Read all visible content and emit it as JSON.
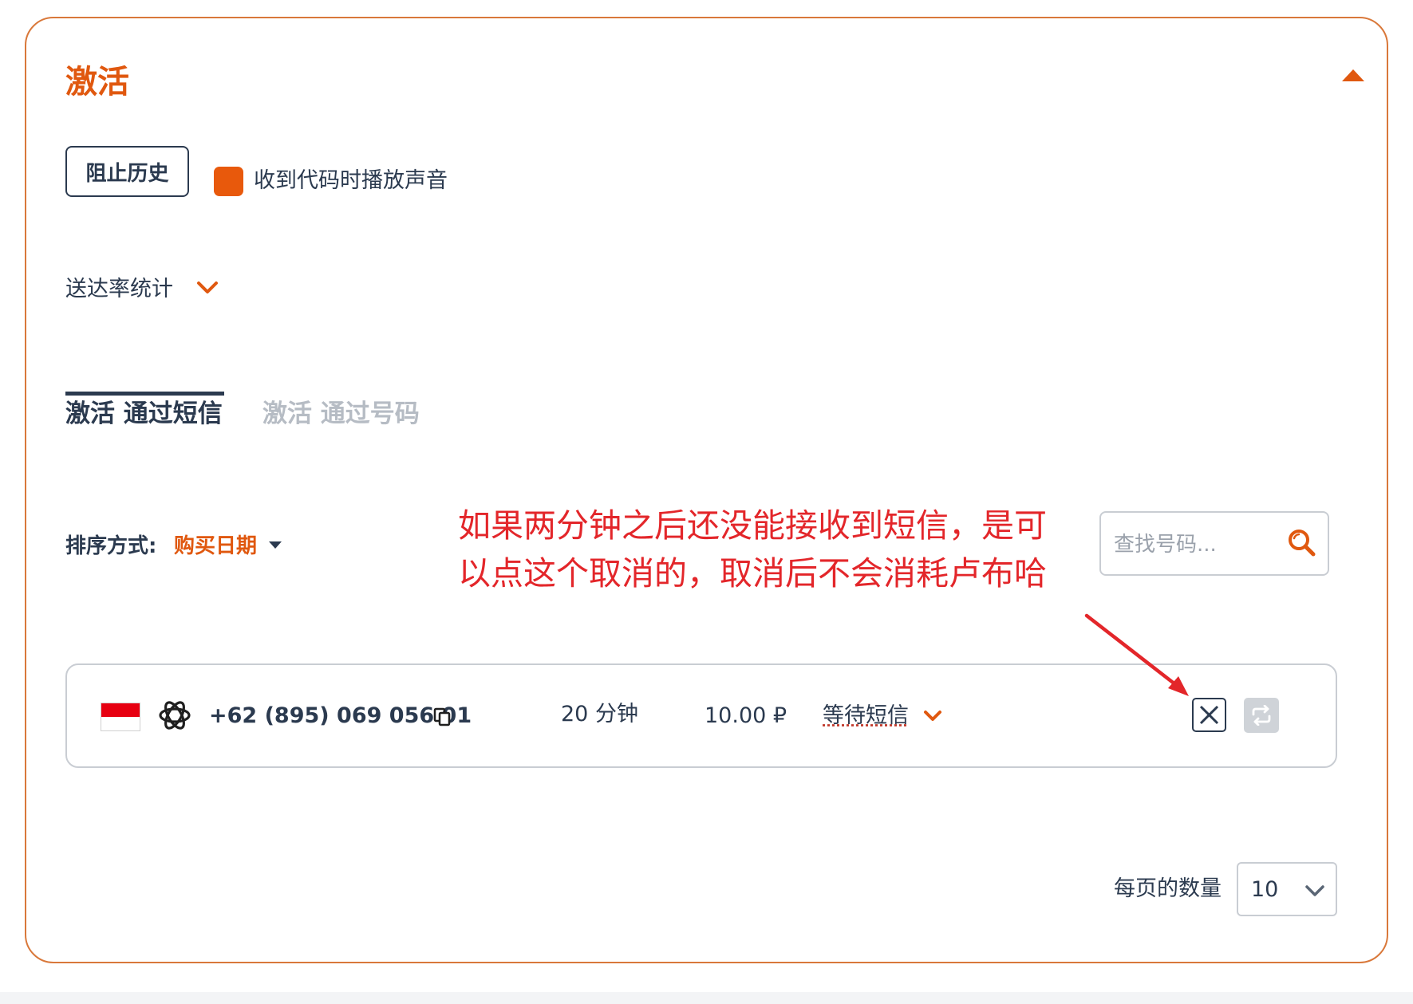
{
  "panel": {
    "title": "激活",
    "block_history_label": "阻止历史",
    "sound_checkbox_label": "收到代码时播放声音",
    "delivery_stats_label": "送达率统计"
  },
  "tabs": [
    {
      "label": "激活 通过短信",
      "active": true
    },
    {
      "label": "激活 通过号码",
      "active": false
    }
  ],
  "sort": {
    "label": "排序方式:",
    "value": "购买日期"
  },
  "search": {
    "placeholder": "查找号码..."
  },
  "annotation": {
    "text": "如果两分钟之后还没能接收到短信，是可\n以点这个取消的，取消后不会消耗卢布哈"
  },
  "activation": {
    "country_flag": "indonesia-flag",
    "service_icon": "openai-icon",
    "phone": "+62 (895) 069 056 01",
    "duration": "20 分钟",
    "price": "10.00 ₽",
    "status": "等待短信"
  },
  "pagination": {
    "per_page_label": "每页的数量",
    "per_page_value": "10"
  },
  "colors": {
    "accent": "#e0580f",
    "text": "#2b3a4f",
    "annotation": "#e3262a",
    "border": "#d9783a"
  }
}
